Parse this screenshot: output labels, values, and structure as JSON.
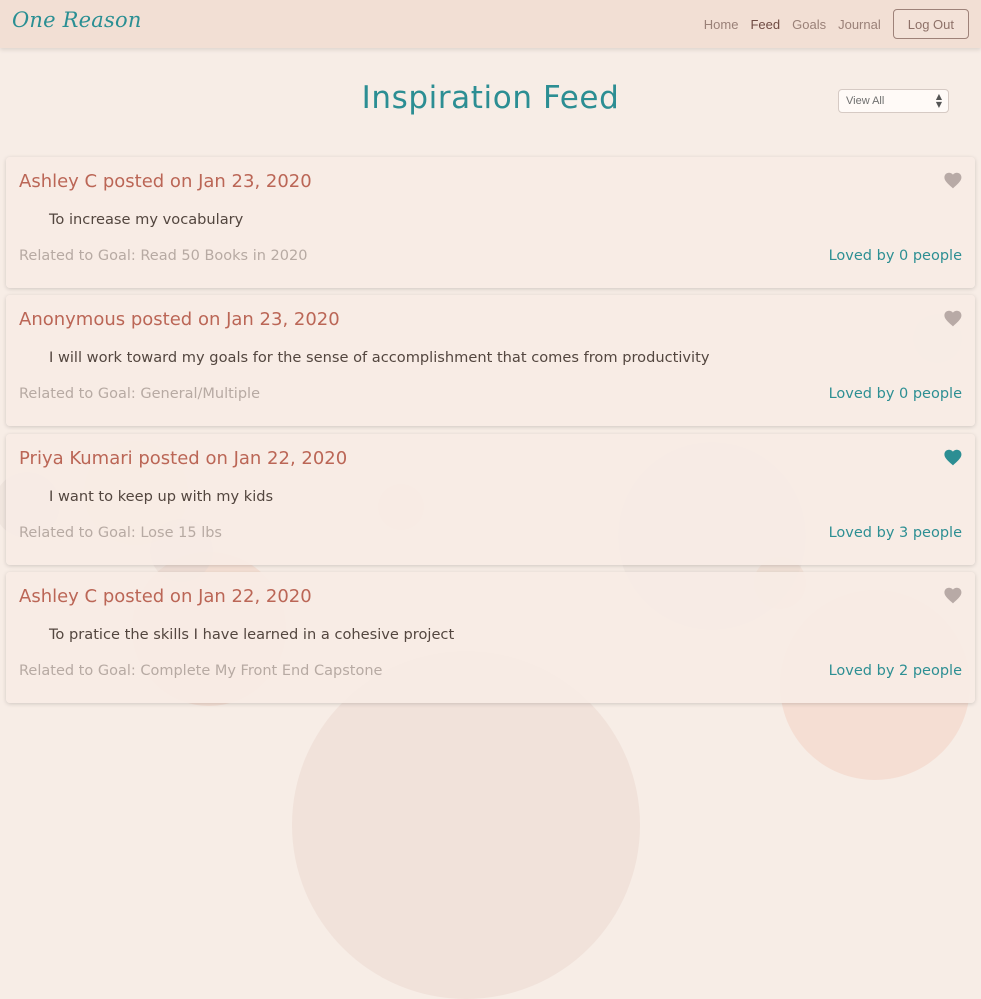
{
  "brand": "One Reason",
  "nav": {
    "home": "Home",
    "feed": "Feed",
    "goals": "Goals",
    "journal": "Journal",
    "logout": "Log Out"
  },
  "page": {
    "title": "Inspiration Feed",
    "filter": {
      "selected": "View All"
    }
  },
  "colors": {
    "accent": "#2c8e93",
    "headline": "#bb6656",
    "heart_off": "#b8aaa6",
    "heart_on": "#2c8e93"
  },
  "posts": [
    {
      "header": "Ashley C posted on Jan 23, 2020",
      "text": "To increase my vocabulary",
      "goal": "Related to Goal: Read 50 Books in 2020",
      "loved": "Loved by 0 people",
      "liked": false,
      "heart_icon": "heart-icon"
    },
    {
      "header": "Anonymous posted on Jan 23, 2020",
      "text": "I will work toward my goals for the sense of accomplishment that comes from productivity",
      "goal": "Related to Goal: General/Multiple",
      "loved": "Loved by 0 people",
      "liked": false,
      "heart_icon": "heart-icon"
    },
    {
      "header": "Priya Kumari posted on Jan 22, 2020",
      "text": "I want to keep up with my kids",
      "goal": "Related to Goal: Lose 15 lbs",
      "loved": "Loved by 3 people",
      "liked": true,
      "heart_icon": "heart-icon"
    },
    {
      "header": "Ashley C posted on Jan 22, 2020",
      "text": "To pratice the skills I have learned in a cohesive project",
      "goal": "Related to Goal: Complete My Front End Capstone",
      "loved": "Loved by 2 people",
      "liked": false,
      "heart_icon": "heart-icon"
    }
  ]
}
